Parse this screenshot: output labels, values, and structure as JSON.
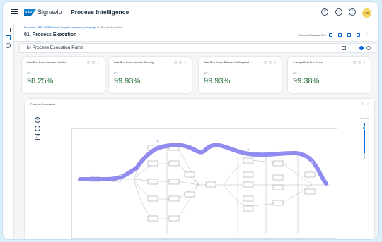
{
  "shell": {
    "logo_text": "SAP",
    "brand": "Signavio",
    "app_title": "Process Intelligence",
    "avatar_initials": "AD"
  },
  "header": {
    "breadcrumb_links": "Processes / P2P / P2P Source / Supplier payments purchasing /",
    "breadcrumb_current": "01. Process Execution",
    "title": "01. Process Execution",
    "current_view": "Current: Purchase Pa..."
  },
  "section": {
    "title": "b) Process Execution Paths"
  },
  "kpis": [
    {
      "title": "Best Run Score: Invoice Creation",
      "label": "KPI",
      "value": "98.25%"
    },
    {
      "title": "Best Run Score: Invoice Blocking",
      "label": "KPI",
      "value": "99.93%"
    },
    {
      "title": "Best Run Score: Release for Payment",
      "label": "KPI",
      "value": "99.93%"
    },
    {
      "title": "Average Best Run Score",
      "label": "KPI",
      "value": "99.38%"
    }
  ],
  "process_card": {
    "title": "Process Executions",
    "slider_label": "Sensitivity"
  },
  "colors": {
    "accent": "#0064d9",
    "highlight_path": "#8b86ee",
    "kpi_value": "#256f3a"
  }
}
